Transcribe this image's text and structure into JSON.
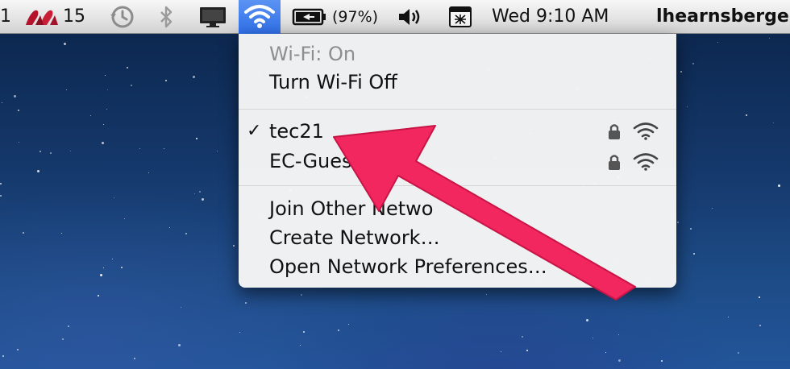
{
  "menubar": {
    "space_number": "1",
    "badge_count": "15",
    "battery_percent": "(97%)",
    "datetime": "Wed 9:10 AM",
    "username": "lhearnsberge"
  },
  "wifi_menu": {
    "status": "Wi-Fi: On",
    "toggle": "Turn Wi-Fi Off",
    "networks": [
      {
        "name": "tec21",
        "connected": true,
        "secured": true
      },
      {
        "name": "EC-Gues",
        "connected": false,
        "secured": true
      }
    ],
    "join_other": "Join Other Netwo",
    "create_network": "Create Network…",
    "open_prefs": "Open Network Preferences…"
  },
  "colors": {
    "arrow": "#f2275f",
    "wifi_highlight": "#3a78ee"
  }
}
